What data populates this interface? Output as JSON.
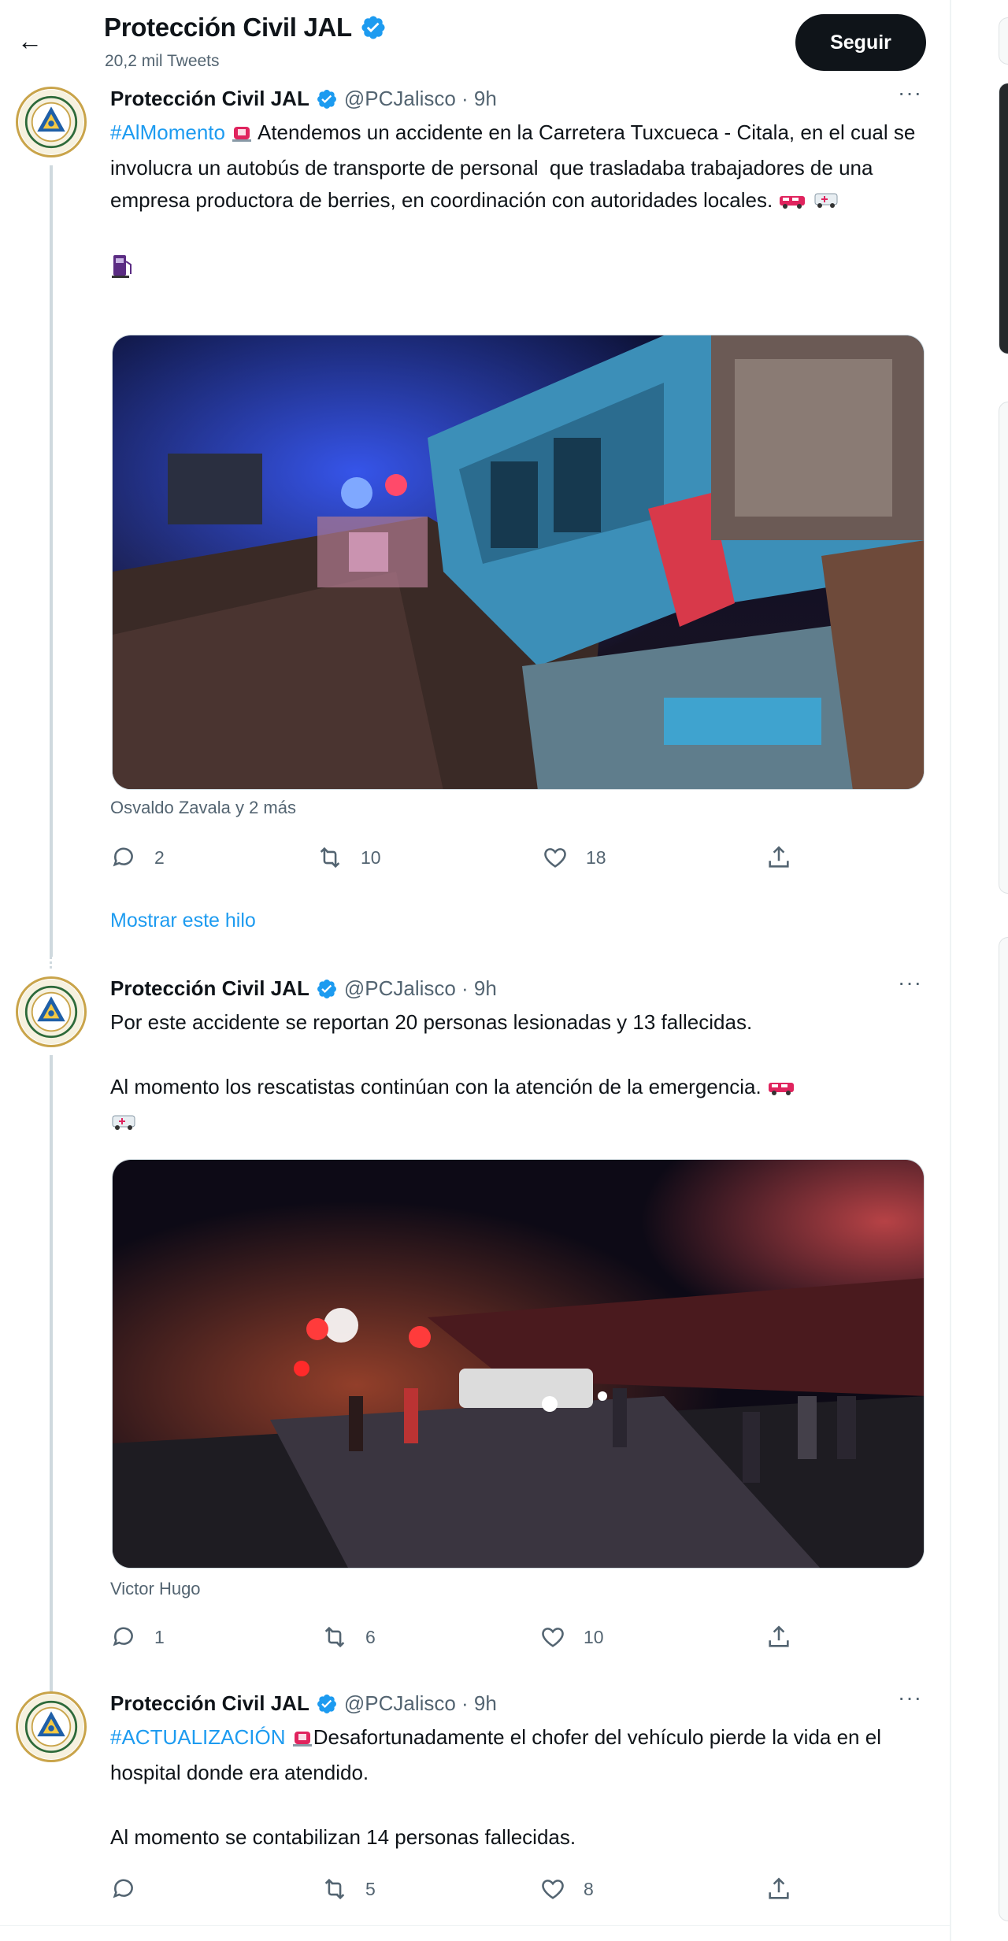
{
  "header": {
    "title": "Protección Civil JAL",
    "tweet_count": "20,2 mil Tweets",
    "follow_label": "Seguir"
  },
  "tweets": [
    {
      "name": "Protección Civil JAL",
      "handle": "@PCJalisco · 9h",
      "hashtag": "#AlMomento",
      "text_lead": " Atendemos un accidente en la Carretera Tuxcueca - Citala, en el cual se involucra un autobús de transporte de personal  que trasladaba trabajadores de una empresa productora de berries, en coordinación con autoridades locales. ",
      "tag_line": "Osvaldo Zavala y 2 más",
      "replies": "2",
      "retweets": "10",
      "likes": "18"
    },
    {
      "name": "Protección Civil JAL",
      "handle": "@PCJalisco · 9h",
      "text_a": "Por este accidente se reportan 20 personas lesionadas y 13 fallecidas.",
      "text_b": "Al momento los rescatistas continúan con la atención de la emergencia.",
      "tag_line": "Victor Hugo",
      "replies": "1",
      "retweets": "6",
      "likes": "10"
    },
    {
      "name": "Protección Civil JAL",
      "handle": "@PCJalisco · 9h",
      "hashtag": "#ACTUALIZACIÓN",
      "text_lead": "Desafortunadamente el chofer del vehículo pierde la vida en el hospital donde era atendido.",
      "text_b": "Al momento se contabilizan 14 personas fallecidas.",
      "replies": "",
      "retweets": "5",
      "likes": "8"
    }
  ],
  "show_thread_label": "Mostrar este hilo",
  "more_label": "···",
  "colors": {
    "accent": "#1d9bf0",
    "text": "#0f1419",
    "muted": "#536471",
    "border": "#eff3f4"
  }
}
